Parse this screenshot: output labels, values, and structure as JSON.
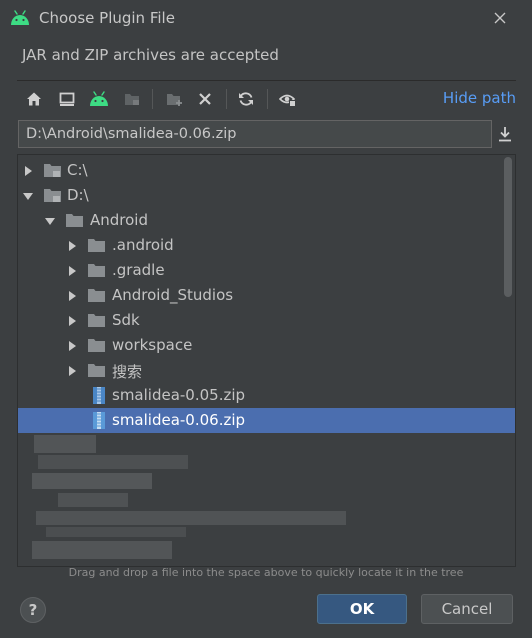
{
  "window": {
    "title": "Choose Plugin File",
    "subtitle": "JAR and ZIP archives are accepted"
  },
  "toolbar": {
    "hide_path_label": "Hide path",
    "buttons": [
      "home-icon",
      "desktop-icon",
      "android-icon",
      "module-icon",
      "new-folder-icon",
      "delete-icon",
      "refresh-icon",
      "show-hidden-icon"
    ]
  },
  "path_field": {
    "value": "D:\\Android\\smalidea-0.06.zip"
  },
  "tree": {
    "items": [
      {
        "label": "C:\\",
        "type": "drive",
        "expanded": false
      },
      {
        "label": "D:\\",
        "type": "drive",
        "expanded": true
      },
      {
        "label": "Android",
        "type": "folder",
        "expanded": true
      },
      {
        "label": ".android",
        "type": "folder",
        "expanded": false
      },
      {
        "label": ".gradle",
        "type": "folder",
        "expanded": false
      },
      {
        "label": "Android_Studios",
        "type": "folder",
        "expanded": false
      },
      {
        "label": "Sdk",
        "type": "folder",
        "expanded": false
      },
      {
        "label": "workspace",
        "type": "folder",
        "expanded": false
      },
      {
        "label": "搜索",
        "type": "folder",
        "expanded": false
      },
      {
        "label": "smalidea-0.05.zip",
        "type": "zip"
      },
      {
        "label": "smalidea-0.06.zip",
        "type": "zip",
        "selected": true
      }
    ]
  },
  "hint": "Drag and drop a file into the space above to quickly locate it in the tree",
  "buttons": {
    "help": "?",
    "ok": "OK",
    "cancel": "Cancel"
  },
  "colors": {
    "background": "#3c3f41",
    "selection": "#4b6eaf",
    "link": "#589df6",
    "ok_button": "#365880",
    "android_green": "#3ddc84"
  }
}
